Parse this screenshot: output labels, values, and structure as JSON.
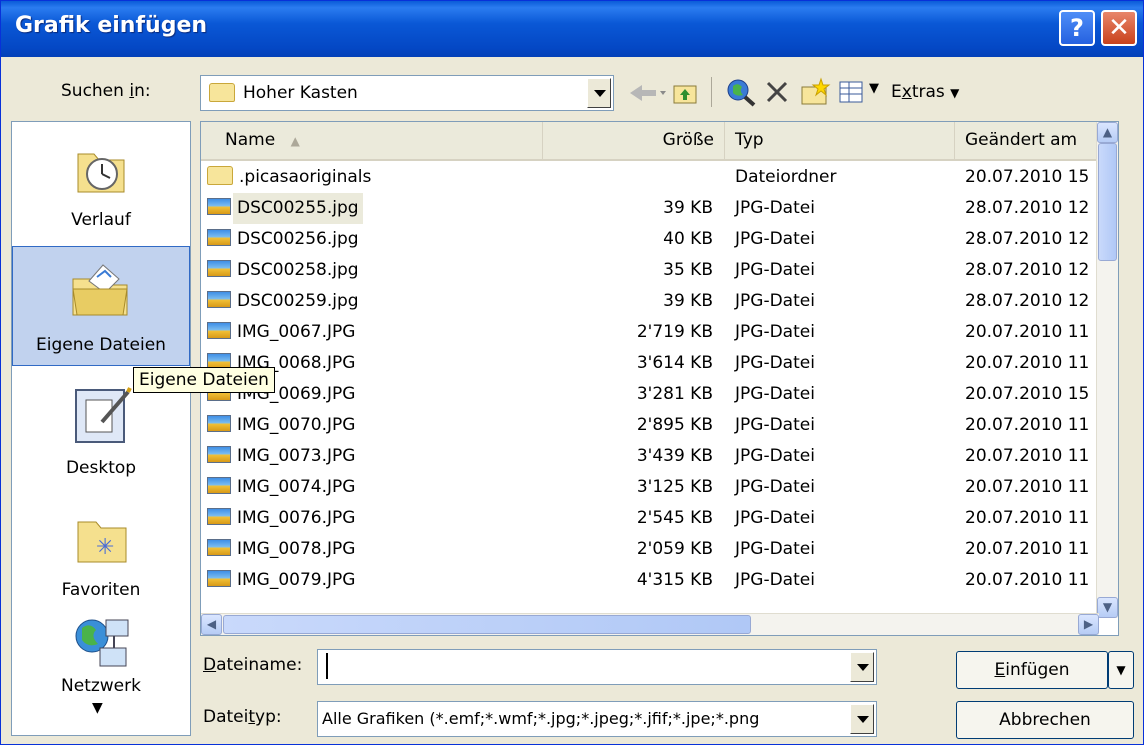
{
  "window": {
    "title": "Grafik einfügen"
  },
  "titlebar": {
    "help_glyph": "?",
    "close_glyph": "✕"
  },
  "lookin": {
    "label_pre": "Suchen ",
    "label_u": "i",
    "label_post": "n:",
    "value": "Hoher Kasten"
  },
  "toolbar": {
    "extras_pre": "E",
    "extras_u": "x",
    "extras_post": "tras"
  },
  "places": [
    {
      "label": "Verlauf",
      "icon": "history-icon"
    },
    {
      "label": "Eigene Dateien",
      "icon": "my-documents-icon"
    },
    {
      "label": "Desktop",
      "icon": "desktop-icon"
    },
    {
      "label": "Favoriten",
      "icon": "favorites-icon"
    },
    {
      "label": "Netzwerk",
      "icon": "network-icon"
    }
  ],
  "tooltip": "Eigene Dateien",
  "columns": {
    "name": "Name",
    "size": "Größe",
    "type": "Typ",
    "date": "Geändert am"
  },
  "files": [
    {
      "name": ".picasaoriginals",
      "size": "",
      "type": "Dateiordner",
      "date": "20.07.2010 15",
      "kind": "folder"
    },
    {
      "name": "DSC00255.jpg",
      "size": "39 KB",
      "type": "JPG-Datei",
      "date": "28.07.2010 12",
      "kind": "image"
    },
    {
      "name": "DSC00256.jpg",
      "size": "40 KB",
      "type": "JPG-Datei",
      "date": "28.07.2010 12",
      "kind": "image"
    },
    {
      "name": "DSC00258.jpg",
      "size": "35 KB",
      "type": "JPG-Datei",
      "date": "28.07.2010 12",
      "kind": "image"
    },
    {
      "name": "DSC00259.jpg",
      "size": "39 KB",
      "type": "JPG-Datei",
      "date": "28.07.2010 12",
      "kind": "image"
    },
    {
      "name": "IMG_0067.JPG",
      "size": "2'719 KB",
      "type": "JPG-Datei",
      "date": "20.07.2010 11",
      "kind": "image"
    },
    {
      "name": "IMG_0068.JPG",
      "size": "3'614 KB",
      "type": "JPG-Datei",
      "date": "20.07.2010 11",
      "kind": "image"
    },
    {
      "name": "IMG_0069.JPG",
      "size": "3'281 KB",
      "type": "JPG-Datei",
      "date": "20.07.2010 15",
      "kind": "image"
    },
    {
      "name": "IMG_0070.JPG",
      "size": "2'895 KB",
      "type": "JPG-Datei",
      "date": "20.07.2010 11",
      "kind": "image"
    },
    {
      "name": "IMG_0073.JPG",
      "size": "3'439 KB",
      "type": "JPG-Datei",
      "date": "20.07.2010 11",
      "kind": "image"
    },
    {
      "name": "IMG_0074.JPG",
      "size": "3'125 KB",
      "type": "JPG-Datei",
      "date": "20.07.2010 11",
      "kind": "image"
    },
    {
      "name": "IMG_0076.JPG",
      "size": "2'545 KB",
      "type": "JPG-Datei",
      "date": "20.07.2010 11",
      "kind": "image"
    },
    {
      "name": "IMG_0078.JPG",
      "size": "2'059 KB",
      "type": "JPG-Datei",
      "date": "20.07.2010 11",
      "kind": "image"
    },
    {
      "name": "IMG_0079.JPG",
      "size": "4'315 KB",
      "type": "JPG-Datei",
      "date": "20.07.2010 11",
      "kind": "image"
    }
  ],
  "filename": {
    "label_u": "D",
    "label_post": "ateiname:",
    "value": ""
  },
  "filetype": {
    "label_pre": "Datei",
    "label_u": "t",
    "label_post": "yp:",
    "value": "Alle Grafiken (*.emf;*.wmf;*.jpg;*.jpeg;*.jfif;*.jpe;*.png"
  },
  "buttons": {
    "insert_u": "E",
    "insert_post": "infügen",
    "cancel": "Abbrechen"
  }
}
